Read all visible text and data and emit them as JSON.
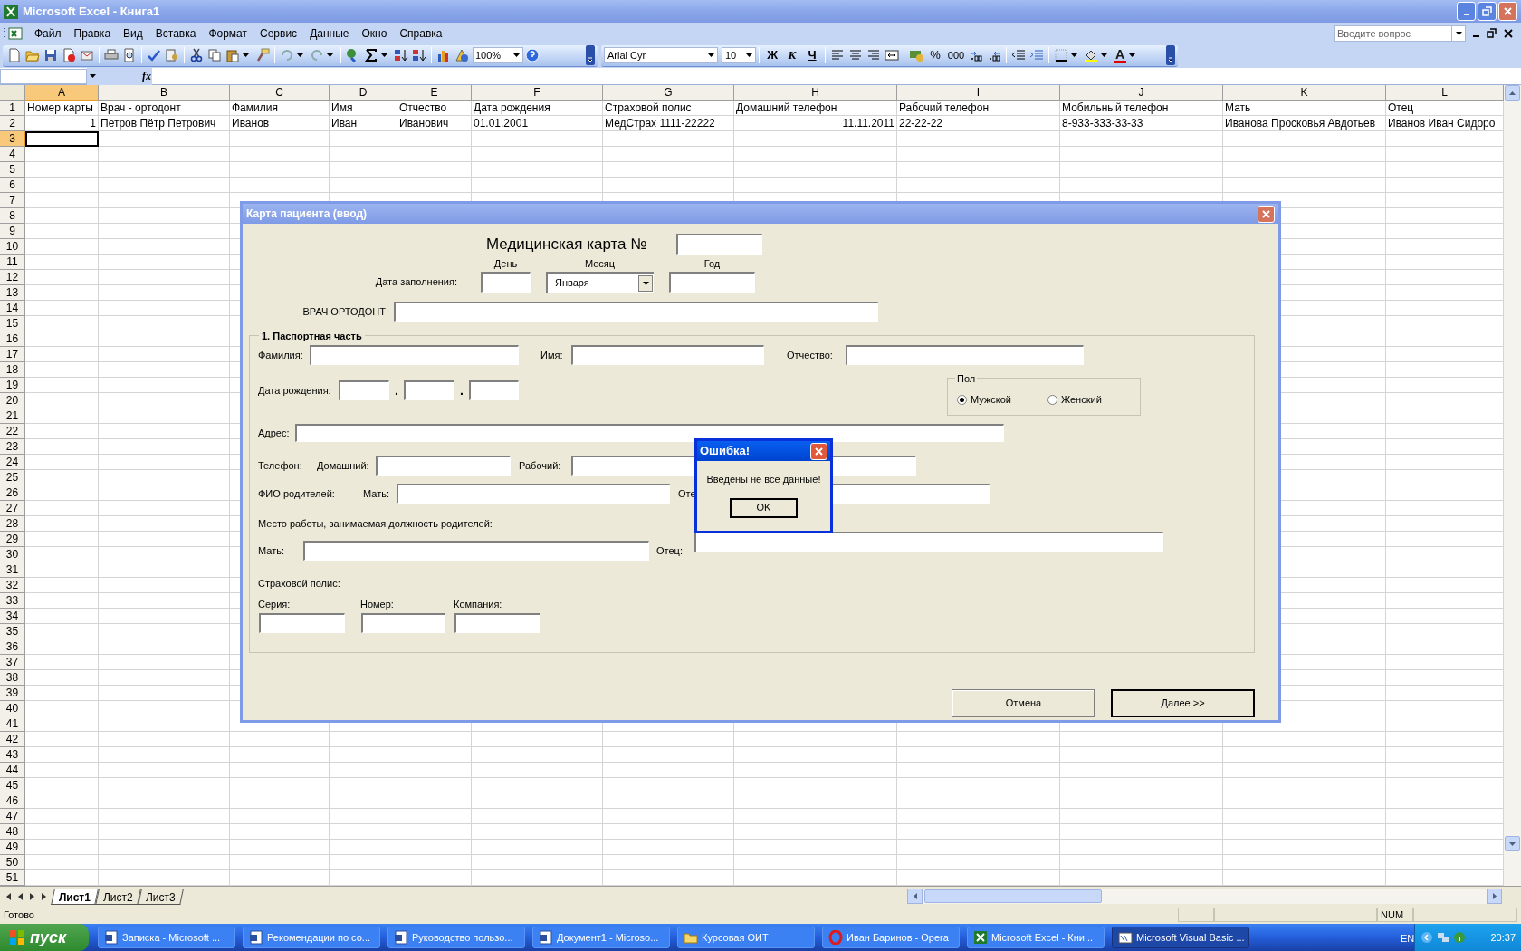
{
  "window": {
    "title": "Microsoft Excel - Книга1"
  },
  "menu": [
    "Файл",
    "Правка",
    "Вид",
    "Вставка",
    "Формат",
    "Сервис",
    "Данные",
    "Окно",
    "Справка"
  ],
  "help_box": {
    "placeholder": "Введите вопрос"
  },
  "toolbar": {
    "zoom": "100%",
    "font": "Arial Cyr",
    "font_size": "10",
    "bold": "Ж",
    "italic": "К",
    "underline": "Ч",
    "percent": "%",
    "thousands": "000",
    "font_color": "A"
  },
  "formula_bar": {
    "fx": "fx"
  },
  "sheet": {
    "columns": [
      {
        "label": "A",
        "selected": true
      },
      {
        "label": "B",
        "selected": false
      },
      {
        "label": "C",
        "selected": false
      },
      {
        "label": "D",
        "selected": false
      },
      {
        "label": "E",
        "selected": false
      },
      {
        "label": "F",
        "selected": false
      },
      {
        "label": "G",
        "selected": false
      },
      {
        "label": "H",
        "selected": false
      },
      {
        "label": "I",
        "selected": false
      },
      {
        "label": "J",
        "selected": false
      },
      {
        "label": "K",
        "selected": false
      },
      {
        "label": "L",
        "selected": false
      }
    ],
    "row_headers": [
      {
        "label": "1",
        "selected": false
      },
      {
        "label": "2",
        "selected": false
      },
      {
        "label": "3",
        "selected": true
      },
      {
        "label": "4",
        "selected": false
      },
      {
        "label": "5",
        "selected": false
      },
      {
        "label": "6",
        "selected": false
      },
      {
        "label": "7",
        "selected": false
      },
      {
        "label": "8",
        "selected": false
      },
      {
        "label": "9",
        "selected": false
      },
      {
        "label": "10",
        "selected": false
      },
      {
        "label": "11",
        "selected": false
      },
      {
        "label": "12",
        "selected": false
      },
      {
        "label": "13",
        "selected": false
      },
      {
        "label": "14",
        "selected": false
      },
      {
        "label": "15",
        "selected": false
      },
      {
        "label": "16",
        "selected": false
      },
      {
        "label": "17",
        "selected": false
      },
      {
        "label": "18",
        "selected": false
      },
      {
        "label": "19",
        "selected": false
      },
      {
        "label": "20",
        "selected": false
      },
      {
        "label": "21",
        "selected": false
      },
      {
        "label": "22",
        "selected": false
      },
      {
        "label": "23",
        "selected": false
      },
      {
        "label": "24",
        "selected": false
      },
      {
        "label": "25",
        "selected": false
      },
      {
        "label": "26",
        "selected": false
      },
      {
        "label": "27",
        "selected": false
      },
      {
        "label": "28",
        "selected": false
      },
      {
        "label": "29",
        "selected": false
      },
      {
        "label": "30",
        "selected": false
      },
      {
        "label": "31",
        "selected": false
      },
      {
        "label": "32",
        "selected": false
      },
      {
        "label": "33",
        "selected": false
      },
      {
        "label": "34",
        "selected": false
      },
      {
        "label": "35",
        "selected": false
      },
      {
        "label": "36",
        "selected": false
      },
      {
        "label": "37",
        "selected": false
      },
      {
        "label": "38",
        "selected": false
      },
      {
        "label": "39",
        "selected": false
      },
      {
        "label": "40",
        "selected": false
      },
      {
        "label": "41",
        "selected": false
      },
      {
        "label": "42",
        "selected": false
      },
      {
        "label": "43",
        "selected": false
      },
      {
        "label": "44",
        "selected": false
      },
      {
        "label": "45",
        "selected": false
      },
      {
        "label": "46",
        "selected": false
      },
      {
        "label": "47",
        "selected": false
      },
      {
        "label": "48",
        "selected": false
      },
      {
        "label": "49",
        "selected": false
      },
      {
        "label": "50",
        "selected": false
      },
      {
        "label": "51",
        "selected": false
      }
    ],
    "rows": [
      [
        {
          "text": "Номер карты",
          "kind": "text"
        },
        {
          "text": "Врач - ортодонт",
          "kind": "text"
        },
        {
          "text": "Фамилия",
          "kind": "text"
        },
        {
          "text": "Имя",
          "kind": "text"
        },
        {
          "text": "Отчество",
          "kind": "text"
        },
        {
          "text": "Дата рождения",
          "kind": "text"
        },
        {
          "text": "Страховой полис",
          "kind": "text"
        },
        {
          "text": "Домашний телефон",
          "kind": "text"
        },
        {
          "text": "Рабочий телефон",
          "kind": "text"
        },
        {
          "text": "Мобильный телефон",
          "kind": "text"
        },
        {
          "text": "Мать",
          "kind": "text"
        },
        {
          "text": "Отец",
          "kind": "text"
        }
      ],
      [
        {
          "text": "1",
          "kind": "number"
        },
        {
          "text": "Петров Пётр Петрович",
          "kind": "text"
        },
        {
          "text": "Иванов",
          "kind": "text"
        },
        {
          "text": "Иван",
          "kind": "text"
        },
        {
          "text": "Иванович",
          "kind": "text"
        },
        {
          "text": "01.01.2001",
          "kind": "text"
        },
        {
          "text": "МедСтрах 1111-22222",
          "kind": "text"
        },
        {
          "text": "11.11.2011",
          "kind": "number"
        },
        {
          "text": "22-22-22",
          "kind": "text"
        },
        {
          "text": "8-933-333-33-33",
          "kind": "text"
        },
        {
          "text": "Иванова Просковья Авдотьев",
          "kind": "text"
        },
        {
          "text": "Иванов Иван Сидоро",
          "kind": "text"
        }
      ]
    ]
  },
  "sheet_tabs": [
    {
      "label": "Лист1",
      "selected": true
    },
    {
      "label": "Лист2",
      "selected": false
    },
    {
      "label": "Лист3",
      "selected": false
    }
  ],
  "status_bar": {
    "text": "Готово",
    "num": "NUM"
  },
  "dialog": {
    "title": "Карта пациента (ввод)",
    "heading": "Медицинская карта №",
    "fill_date": {
      "label": "Дата заполнения:",
      "day_label": "День",
      "month_label": "Месяц",
      "year_label": "Год",
      "month": "Января"
    },
    "doctor_label": "ВРАЧ ОРТОДОНТ:",
    "section": {
      "title": "1. Паспортная часть",
      "surname": "Фамилия:",
      "name": "Имя:",
      "patronymic": "Отчество:",
      "birth_date": "Дата рождения:",
      "separators": [
        ".",
        "."
      ],
      "gender": {
        "title": "Пол",
        "options": [
          {
            "label": "Мужской",
            "selected": true
          },
          {
            "label": "Женский",
            "selected": false
          }
        ]
      },
      "address": "Адрес:",
      "phone": "Телефон:",
      "home_phone": "Домашний:",
      "work_phone": "Рабочий:",
      "parents": "ФИО родителей:",
      "mother": "Мать:",
      "father": "Оте",
      "work_heading": "Место работы, занимаемая должность родителей:",
      "work_mother": "Мать:",
      "work_father": "Отец:",
      "policy": "Страховой полис:",
      "series": "Серия:",
      "number": "Номер:",
      "company": "Компания:"
    },
    "buttons": [
      {
        "label": "Отмена",
        "default": false
      },
      {
        "label": "Далее >>",
        "default": true
      }
    ]
  },
  "message_box": {
    "title": "Ошибка!",
    "text": "Введены не все данные!",
    "button": "OK"
  },
  "taskbar": {
    "start": "пуск",
    "items": [
      {
        "label": "Записка - Microsoft ...",
        "kind": "word",
        "selected": false
      },
      {
        "label": "Рекомендации по со...",
        "kind": "word",
        "selected": false
      },
      {
        "label": "Руководство пользо...",
        "kind": "word",
        "selected": false
      },
      {
        "label": "Документ1 - Microso...",
        "kind": "word",
        "selected": false
      },
      {
        "label": "Курсовая ОИТ",
        "kind": "folder",
        "selected": false
      },
      {
        "label": "Иван Баринов - Opera",
        "kind": "opera",
        "selected": false
      },
      {
        "label": "Microsoft Excel - Кни...",
        "kind": "excel",
        "selected": false
      },
      {
        "label": "Microsoft Visual Basic ...",
        "kind": "vba",
        "selected": true
      }
    ],
    "language": "EN",
    "time": "20:37"
  }
}
